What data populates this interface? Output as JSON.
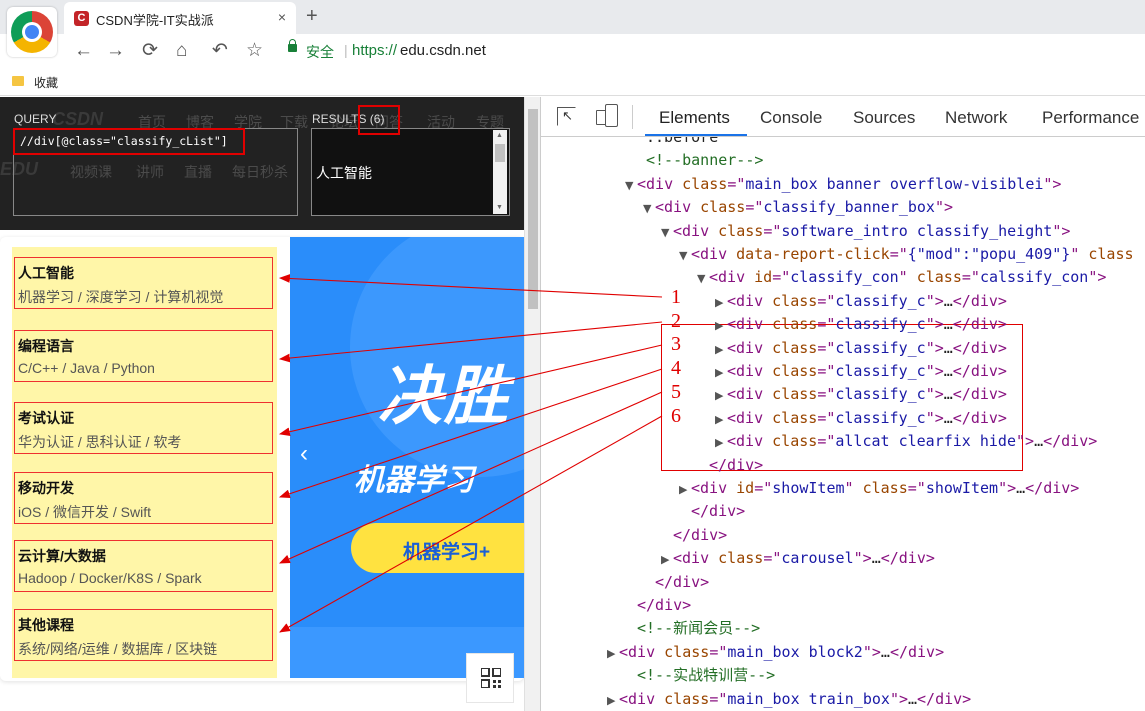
{
  "browser": {
    "tab_title": "CSDN学院-IT实战派",
    "tab_favicon": "C",
    "tab_close": "×",
    "new_tab": "+",
    "nav": {
      "back": "←",
      "forward": "→",
      "reload": "⟳",
      "home": "⌂",
      "undo": "↶",
      "star": "☆"
    },
    "omnibox": {
      "secure_label": "安全",
      "separator": "|",
      "scheme": "https://",
      "host": "edu.csdn.net"
    },
    "bookmarks_label": "收藏"
  },
  "xpath_helper": {
    "query_label": "QUERY",
    "results_label": "RESULTS (6)",
    "query_text": "//div[@class=\"classify_cList\"]",
    "result_text": "人工智能",
    "scroll_up": "▲",
    "scroll_down": "▼",
    "background_nav": [
      "CSDN",
      "首页",
      "博客",
      "学院",
      "下载",
      "论坛",
      "问答",
      "活动",
      "专题"
    ],
    "background_nav2": [
      "EDU",
      "视频课",
      "讲师",
      "直播",
      "每日秒杀",
      "会员免费",
      "12月限"
    ]
  },
  "categories": [
    {
      "name": "人工智能",
      "subs": "机器学习 / 深度学习 / 计算机视觉"
    },
    {
      "name": "编程语言",
      "subs": "C/C++ / Java / Python"
    },
    {
      "name": "考试认证",
      "subs": "华为认证 / 思科认证 / 软考"
    },
    {
      "name": "移动开发",
      "subs": "iOS / 微信开发 / Swift"
    },
    {
      "name": "云计算/大数据",
      "subs": "Hadoop / Docker/K8S / Spark"
    },
    {
      "name": "其他课程",
      "subs": "系统/网络/运维 / 数据库 / 区块链"
    }
  ],
  "banner": {
    "headline": "决胜",
    "subline": "机器学习",
    "button_text": "机器学习+",
    "prev_arrow": "‹"
  },
  "devtools": {
    "tabs": [
      "Elements",
      "Console",
      "Sources",
      "Network",
      "Performance"
    ],
    "active_tab": "Elements",
    "lines": [
      {
        "indent": 5,
        "tri": "",
        "html": [
          {
            "c": "txt",
            "t": "::before"
          }
        ]
      },
      {
        "indent": 5,
        "tri": "",
        "html": [
          {
            "c": "cm",
            "t": "<!--banner-->"
          }
        ]
      },
      {
        "indent": 4,
        "tri": "▼",
        "html": [
          {
            "c": "tag",
            "t": "<div "
          },
          {
            "c": "an",
            "t": "class"
          },
          {
            "c": "tag",
            "t": "=\""
          },
          {
            "c": "av",
            "t": "main_box banner overflow-visiblei"
          },
          {
            "c": "tag",
            "t": "\">"
          }
        ]
      },
      {
        "indent": 6,
        "tri": "▼",
        "html": [
          {
            "c": "tag",
            "t": "<div "
          },
          {
            "c": "an",
            "t": "class"
          },
          {
            "c": "tag",
            "t": "=\""
          },
          {
            "c": "av",
            "t": "classify_banner_box"
          },
          {
            "c": "tag",
            "t": "\">"
          }
        ]
      },
      {
        "indent": 8,
        "tri": "▼",
        "html": [
          {
            "c": "tag",
            "t": "<div "
          },
          {
            "c": "an",
            "t": "class"
          },
          {
            "c": "tag",
            "t": "=\""
          },
          {
            "c": "av",
            "t": "software_intro classify_height"
          },
          {
            "c": "tag",
            "t": "\">"
          }
        ]
      },
      {
        "indent": 10,
        "tri": "▼",
        "html": [
          {
            "c": "tag",
            "t": "<div "
          },
          {
            "c": "an",
            "t": "data-report-click"
          },
          {
            "c": "tag",
            "t": "=\""
          },
          {
            "c": "av",
            "t": "{\"mod\":\"popu_409\"}"
          },
          {
            "c": "tag",
            "t": "\" "
          },
          {
            "c": "an",
            "t": "class"
          }
        ]
      },
      {
        "indent": 12,
        "tri": "▼",
        "html": [
          {
            "c": "tag",
            "t": "<div "
          },
          {
            "c": "an",
            "t": "id"
          },
          {
            "c": "tag",
            "t": "=\""
          },
          {
            "c": "av",
            "t": "classify_con"
          },
          {
            "c": "tag",
            "t": "\" "
          },
          {
            "c": "an",
            "t": "class"
          },
          {
            "c": "tag",
            "t": "=\""
          },
          {
            "c": "av",
            "t": "calssify_con"
          },
          {
            "c": "tag",
            "t": "\">"
          }
        ]
      },
      {
        "indent": 14,
        "tri": "▶",
        "html": [
          {
            "c": "tag",
            "t": "<div "
          },
          {
            "c": "an",
            "t": "class"
          },
          {
            "c": "tag",
            "t": "=\""
          },
          {
            "c": "av",
            "t": "classify_c"
          },
          {
            "c": "tag",
            "t": "\">"
          },
          {
            "c": "txt",
            "t": "…"
          },
          {
            "c": "tag",
            "t": "</div>"
          }
        ]
      },
      {
        "indent": 14,
        "tri": "▶",
        "html": [
          {
            "c": "tag",
            "t": "<div "
          },
          {
            "c": "an",
            "t": "class"
          },
          {
            "c": "tag",
            "t": "=\""
          },
          {
            "c": "av",
            "t": "classify_c"
          },
          {
            "c": "tag",
            "t": "\">"
          },
          {
            "c": "txt",
            "t": "…"
          },
          {
            "c": "tag",
            "t": "</div>"
          }
        ]
      },
      {
        "indent": 14,
        "tri": "▶",
        "html": [
          {
            "c": "tag",
            "t": "<div "
          },
          {
            "c": "an",
            "t": "class"
          },
          {
            "c": "tag",
            "t": "=\""
          },
          {
            "c": "av",
            "t": "classify_c"
          },
          {
            "c": "tag",
            "t": "\">"
          },
          {
            "c": "txt",
            "t": "…"
          },
          {
            "c": "tag",
            "t": "</div>"
          }
        ]
      },
      {
        "indent": 14,
        "tri": "▶",
        "html": [
          {
            "c": "tag",
            "t": "<div "
          },
          {
            "c": "an",
            "t": "class"
          },
          {
            "c": "tag",
            "t": "=\""
          },
          {
            "c": "av",
            "t": "classify_c"
          },
          {
            "c": "tag",
            "t": "\">"
          },
          {
            "c": "txt",
            "t": "…"
          },
          {
            "c": "tag",
            "t": "</div>"
          }
        ]
      },
      {
        "indent": 14,
        "tri": "▶",
        "html": [
          {
            "c": "tag",
            "t": "<div "
          },
          {
            "c": "an",
            "t": "class"
          },
          {
            "c": "tag",
            "t": "=\""
          },
          {
            "c": "av",
            "t": "classify_c"
          },
          {
            "c": "tag",
            "t": "\">"
          },
          {
            "c": "txt",
            "t": "…"
          },
          {
            "c": "tag",
            "t": "</div>"
          }
        ]
      },
      {
        "indent": 14,
        "tri": "▶",
        "html": [
          {
            "c": "tag",
            "t": "<div "
          },
          {
            "c": "an",
            "t": "class"
          },
          {
            "c": "tag",
            "t": "=\""
          },
          {
            "c": "av",
            "t": "classify_c"
          },
          {
            "c": "tag",
            "t": "\">"
          },
          {
            "c": "txt",
            "t": "…"
          },
          {
            "c": "tag",
            "t": "</div>"
          }
        ]
      },
      {
        "indent": 14,
        "tri": "▶",
        "html": [
          {
            "c": "tag",
            "t": "<div "
          },
          {
            "c": "an",
            "t": "class"
          },
          {
            "c": "tag",
            "t": "=\""
          },
          {
            "c": "av",
            "t": "allcat clearfix hide"
          },
          {
            "c": "tag",
            "t": "\">"
          },
          {
            "c": "txt",
            "t": "…"
          },
          {
            "c": "tag",
            "t": "</div>"
          }
        ]
      },
      {
        "indent": 12,
        "tri": "",
        "html": [
          {
            "c": "tag",
            "t": "</div>"
          }
        ]
      },
      {
        "indent": 10,
        "tri": "▶",
        "html": [
          {
            "c": "tag",
            "t": "<div "
          },
          {
            "c": "an",
            "t": "id"
          },
          {
            "c": "tag",
            "t": "=\""
          },
          {
            "c": "av",
            "t": "showItem"
          },
          {
            "c": "tag",
            "t": "\" "
          },
          {
            "c": "an",
            "t": "class"
          },
          {
            "c": "tag",
            "t": "=\""
          },
          {
            "c": "av",
            "t": "showItem"
          },
          {
            "c": "tag",
            "t": "\">"
          },
          {
            "c": "txt",
            "t": "…"
          },
          {
            "c": "tag",
            "t": "</div>"
          }
        ]
      },
      {
        "indent": 10,
        "tri": "",
        "html": [
          {
            "c": "tag",
            "t": "</div>"
          }
        ]
      },
      {
        "indent": 8,
        "tri": "",
        "html": [
          {
            "c": "tag",
            "t": "</div>"
          }
        ]
      },
      {
        "indent": 8,
        "tri": "▶",
        "html": [
          {
            "c": "tag",
            "t": "<div "
          },
          {
            "c": "an",
            "t": "class"
          },
          {
            "c": "tag",
            "t": "=\""
          },
          {
            "c": "av",
            "t": "carousel"
          },
          {
            "c": "tag",
            "t": "\">"
          },
          {
            "c": "txt",
            "t": "…"
          },
          {
            "c": "tag",
            "t": "</div>"
          }
        ]
      },
      {
        "indent": 6,
        "tri": "",
        "html": [
          {
            "c": "tag",
            "t": "</div>"
          }
        ]
      },
      {
        "indent": 4,
        "tri": "",
        "html": [
          {
            "c": "tag",
            "t": "</div>"
          }
        ]
      },
      {
        "indent": 4,
        "tri": "",
        "html": [
          {
            "c": "cm",
            "t": "<!--新闻会员-->"
          }
        ]
      },
      {
        "indent": 2,
        "tri": "▶",
        "html": [
          {
            "c": "tag",
            "t": "<div "
          },
          {
            "c": "an",
            "t": "class"
          },
          {
            "c": "tag",
            "t": "=\""
          },
          {
            "c": "av",
            "t": "main_box block2"
          },
          {
            "c": "tag",
            "t": "\">"
          },
          {
            "c": "txt",
            "t": "…"
          },
          {
            "c": "tag",
            "t": "</div>"
          }
        ]
      },
      {
        "indent": 4,
        "tri": "",
        "html": [
          {
            "c": "cm",
            "t": "<!--实战特训营-->"
          }
        ]
      },
      {
        "indent": 2,
        "tri": "▶",
        "html": [
          {
            "c": "tag",
            "t": "<div "
          },
          {
            "c": "an",
            "t": "class"
          },
          {
            "c": "tag",
            "t": "=\""
          },
          {
            "c": "av",
            "t": "main_box train_box"
          },
          {
            "c": "tag",
            "t": "\">"
          },
          {
            "c": "txt",
            "t": "…"
          },
          {
            "c": "tag",
            "t": "</div>"
          }
        ]
      }
    ]
  },
  "annotations": {
    "numbers": [
      "1",
      "2",
      "3",
      "4",
      "5",
      "6"
    ],
    "color": "#e00000"
  }
}
